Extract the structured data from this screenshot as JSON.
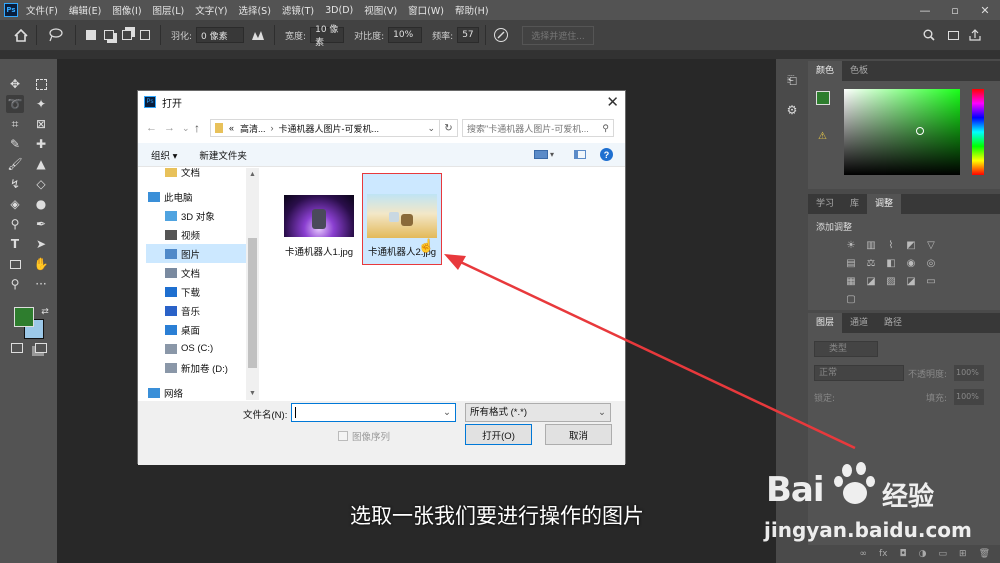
{
  "app": {
    "logo": "Ps",
    "menu": [
      "文件(F)",
      "编辑(E)",
      "图像(I)",
      "图层(L)",
      "文字(Y)",
      "选择(S)",
      "滤镜(T)",
      "3D(D)",
      "视图(V)",
      "窗口(W)",
      "帮助(H)"
    ]
  },
  "options": {
    "feather_label": "羽化:",
    "feather_value": "0 像素",
    "width_label": "宽度:",
    "width_value": "10 像素",
    "contrast_label": "对比度:",
    "contrast_value": "10%",
    "freq_label": "频率:",
    "freq_value": "57",
    "select_mask": "选择并遮住..."
  },
  "panels": {
    "color_tabs": [
      "颜色",
      "色板"
    ],
    "adjust_tabs": [
      "学习",
      "库",
      "调整"
    ],
    "adjust_title": "添加调整",
    "layer_tabs": [
      "图层",
      "通道",
      "路径"
    ],
    "layer_filter": "类型",
    "blend_mode": "正常",
    "opacity_label": "不透明度:",
    "opacity_value": "100%",
    "lock_label": "锁定:",
    "fill_label": "填充:",
    "fill_value": "100%"
  },
  "dialog": {
    "title": "打开",
    "path_prefix": "«",
    "path_1": "高清...",
    "path_2": "卡通机器人图片-可爱机...",
    "search_placeholder": "搜索\"卡通机器人图片-可爱机...",
    "organize": "组织 ▾",
    "new_folder": "新建文件夹",
    "nav": [
      {
        "label": "文档",
        "icon": "folder-icon",
        "color": "#e8c15a"
      },
      {
        "label": "此电脑",
        "icon": "computer-icon",
        "color": "#3a8fd8"
      },
      {
        "label": "3D 对象",
        "icon": "3d-objects-icon",
        "color": "#4fa3e0"
      },
      {
        "label": "视频",
        "icon": "video-icon",
        "color": "#555"
      },
      {
        "label": "图片",
        "icon": "pictures-icon",
        "color": "#4f89c9"
      },
      {
        "label": "文档",
        "icon": "documents-icon",
        "color": "#7a8aa0"
      },
      {
        "label": "下载",
        "icon": "download-icon",
        "color": "#1e6fd0"
      },
      {
        "label": "音乐",
        "icon": "music-icon",
        "color": "#2a62c8"
      },
      {
        "label": "桌面",
        "icon": "desktop-icon",
        "color": "#2b7fd5"
      },
      {
        "label": "OS (C:)",
        "icon": "drive-icon",
        "color": "#8a97a8"
      },
      {
        "label": "新加卷 (D:)",
        "icon": "drive-icon",
        "color": "#8a97a8"
      },
      {
        "label": "网络",
        "icon": "network-icon",
        "color": "#3a8fd8"
      }
    ],
    "files": [
      {
        "name": "卡通机器人1.jpg"
      },
      {
        "name": "卡通机器人2.jpg"
      }
    ],
    "filename_label": "文件名(N):",
    "filename_value": "",
    "filter": "所有格式 (*.*)",
    "image_seq": "图像序列",
    "open": "打开(O)",
    "cancel": "取消"
  },
  "caption": "选取一张我们要进行操作的图片",
  "watermark": {
    "brand": "Bai",
    "brand2": "经验",
    "url": "jingyan.baidu.com"
  },
  "colors": {
    "foreground": "#2e7d2e",
    "background": "#9cc8e8",
    "annotation": "#e8393c"
  }
}
